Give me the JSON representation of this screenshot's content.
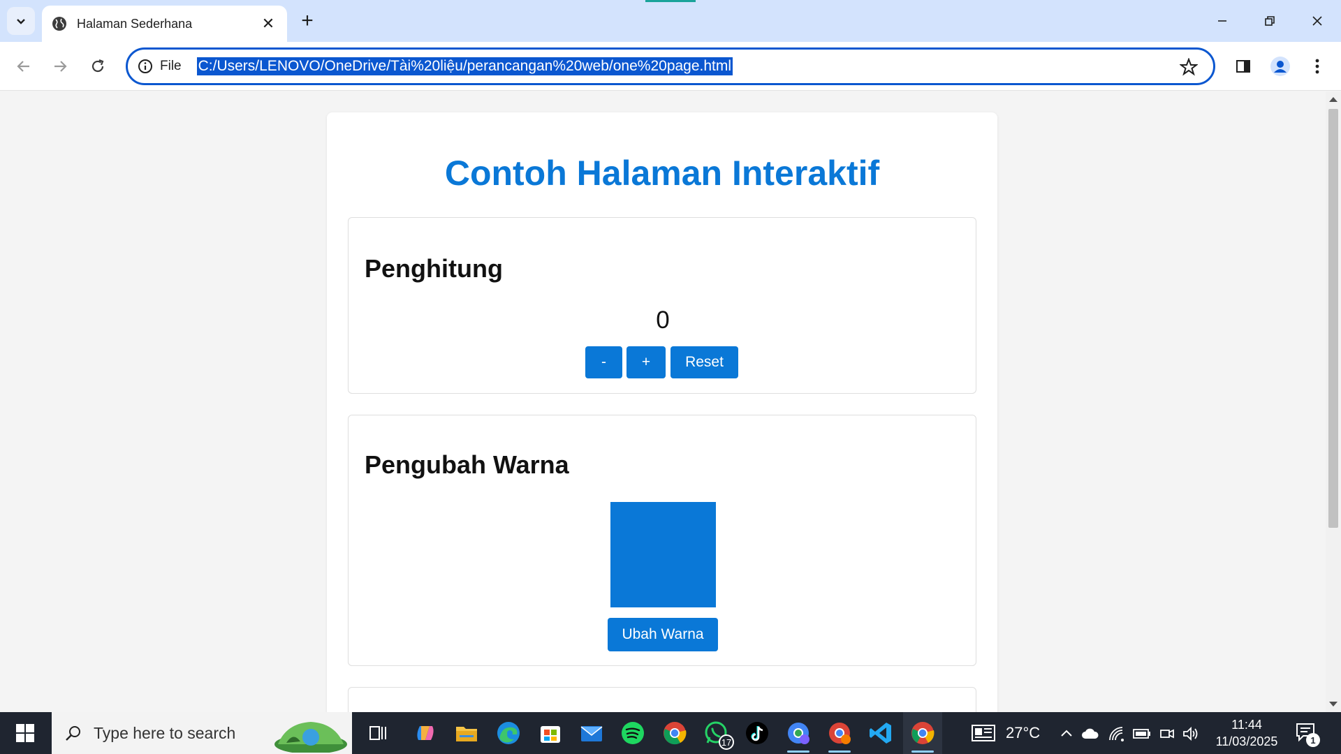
{
  "browser": {
    "tab_title": "Halaman Sederhana",
    "omnibox_scheme": "File",
    "url": "C:/Users/LENOVO/OneDrive/Tài%20liệu/perancangan%20web/one%20page.html"
  },
  "page": {
    "title": "Contoh Halaman Interaktif",
    "counter": {
      "heading": "Penghitung",
      "value": "0",
      "minus_label": "-",
      "plus_label": "+",
      "reset_label": "Reset"
    },
    "color_changer": {
      "heading": "Pengubah Warna",
      "box_color": "#0a78d7",
      "button_label": "Ubah Warna"
    }
  },
  "colors": {
    "accent": "#0a78d7",
    "tabstrip": "#d3e3fd",
    "omnibox_border": "#0b57d0"
  },
  "taskbar": {
    "search_placeholder": "Type here to search",
    "whatsapp_badge": "17",
    "temperature": "27°C",
    "time": "11:44",
    "date": "11/03/2025",
    "notification_count": "1",
    "pinned_icons": [
      "task-view-icon",
      "copilot-icon",
      "file-explorer-icon",
      "edge-icon",
      "microsoft-store-icon",
      "mail-icon",
      "spotify-icon",
      "chrome-icon",
      "whatsapp-icon",
      "tiktok-icon",
      "chrome-profile-icon",
      "chrome-profile-2-icon",
      "vscode-icon",
      "chrome-active-icon"
    ]
  }
}
